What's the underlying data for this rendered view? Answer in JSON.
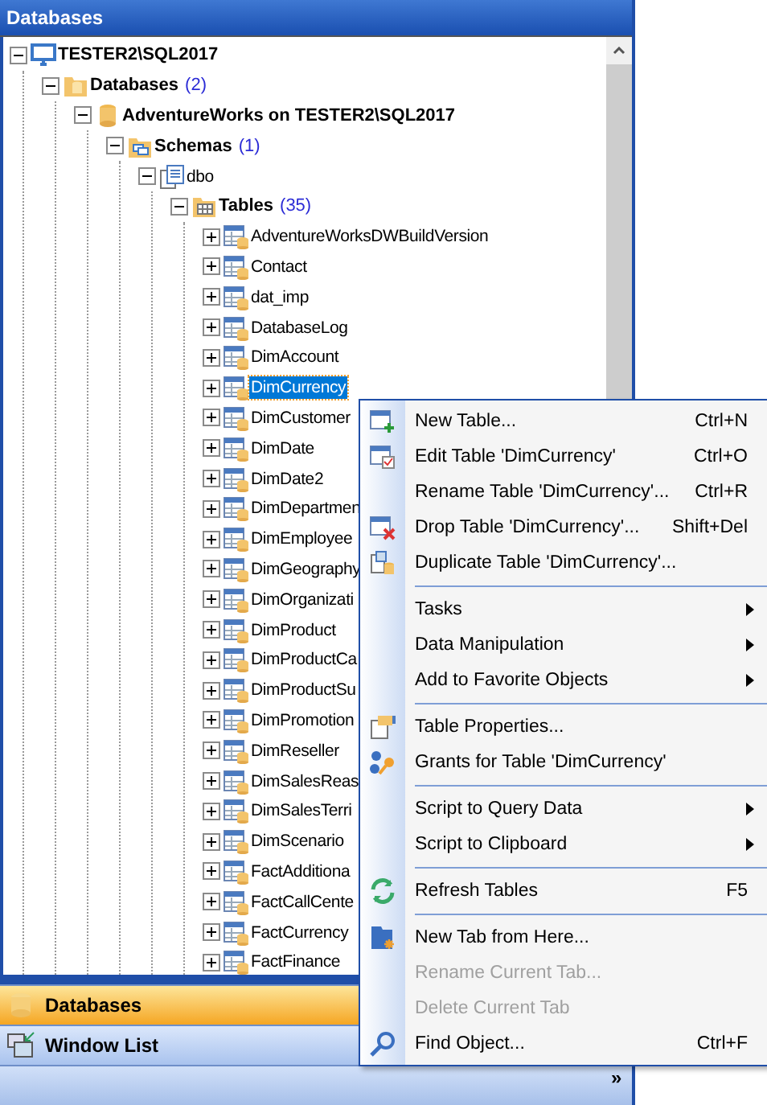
{
  "panel": {
    "title": "Databases"
  },
  "tree": [
    {
      "label": "TESTER2\\SQL2017",
      "kind": "server",
      "bold": true,
      "expanded": true,
      "selected": false,
      "children": [
        {
          "label": "Databases",
          "count": "(2)",
          "kind": "folder-db",
          "bold": true,
          "expanded": true,
          "selected": false,
          "children": [
            {
              "label": "AdventureWorks on TESTER2\\SQL2017",
              "kind": "database",
              "bold": true,
              "expanded": true,
              "selected": false,
              "children": [
                {
                  "label": "Schemas",
                  "count": "(1)",
                  "kind": "folder-schema",
                  "bold": true,
                  "expanded": true,
                  "selected": false,
                  "children": [
                    {
                      "label": "dbo",
                      "kind": "schema",
                      "bold": false,
                      "expanded": true,
                      "selected": false,
                      "children": [
                        {
                          "label": "Tables",
                          "count": "(35)",
                          "kind": "folder-table",
                          "bold": true,
                          "expanded": true,
                          "selected": false,
                          "children": [
                            {
                              "label": "AdventureWorksDWBuildVersion",
                              "kind": "table",
                              "bold": false,
                              "expanded": false,
                              "selected": false
                            },
                            {
                              "label": "Contact",
                              "kind": "table",
                              "bold": false,
                              "expanded": false,
                              "selected": false
                            },
                            {
                              "label": "dat_imp",
                              "kind": "table",
                              "bold": false,
                              "expanded": false,
                              "selected": false
                            },
                            {
                              "label": "DatabaseLog",
                              "kind": "table",
                              "bold": false,
                              "expanded": false,
                              "selected": false
                            },
                            {
                              "label": "DimAccount",
                              "kind": "table",
                              "bold": false,
                              "expanded": false,
                              "selected": false
                            },
                            {
                              "label": "DimCurrency",
                              "kind": "table",
                              "bold": false,
                              "expanded": false,
                              "selected": true
                            },
                            {
                              "label": "DimCustomer",
                              "kind": "table",
                              "bold": false,
                              "expanded": false,
                              "selected": false
                            },
                            {
                              "label": "DimDate",
                              "kind": "table",
                              "bold": false,
                              "expanded": false,
                              "selected": false
                            },
                            {
                              "label": "DimDate2",
                              "kind": "table",
                              "bold": false,
                              "expanded": false,
                              "selected": false
                            },
                            {
                              "label": "DimDepartmen",
                              "kind": "table",
                              "bold": false,
                              "expanded": false,
                              "selected": false
                            },
                            {
                              "label": "DimEmployee",
                              "kind": "table",
                              "bold": false,
                              "expanded": false,
                              "selected": false
                            },
                            {
                              "label": "DimGeography",
                              "kind": "table",
                              "bold": false,
                              "expanded": false,
                              "selected": false
                            },
                            {
                              "label": "DimOrganizati",
                              "kind": "table",
                              "bold": false,
                              "expanded": false,
                              "selected": false
                            },
                            {
                              "label": "DimProduct",
                              "kind": "table",
                              "bold": false,
                              "expanded": false,
                              "selected": false
                            },
                            {
                              "label": "DimProductCa",
                              "kind": "table",
                              "bold": false,
                              "expanded": false,
                              "selected": false
                            },
                            {
                              "label": "DimProductSu",
                              "kind": "table",
                              "bold": false,
                              "expanded": false,
                              "selected": false
                            },
                            {
                              "label": "DimPromotion",
                              "kind": "table",
                              "bold": false,
                              "expanded": false,
                              "selected": false
                            },
                            {
                              "label": "DimReseller",
                              "kind": "table",
                              "bold": false,
                              "expanded": false,
                              "selected": false
                            },
                            {
                              "label": "DimSalesReas",
                              "kind": "table",
                              "bold": false,
                              "expanded": false,
                              "selected": false
                            },
                            {
                              "label": "DimSalesTerri",
                              "kind": "table",
                              "bold": false,
                              "expanded": false,
                              "selected": false
                            },
                            {
                              "label": "DimScenario",
                              "kind": "table",
                              "bold": false,
                              "expanded": false,
                              "selected": false
                            },
                            {
                              "label": "FactAdditiona",
                              "kind": "table",
                              "bold": false,
                              "expanded": false,
                              "selected": false
                            },
                            {
                              "label": "FactCallCente",
                              "kind": "table",
                              "bold": false,
                              "expanded": false,
                              "selected": false
                            },
                            {
                              "label": "FactCurrency",
                              "kind": "table",
                              "bold": false,
                              "expanded": false,
                              "selected": false
                            },
                            {
                              "label": "FactFinance",
                              "kind": "table",
                              "bold": false,
                              "expanded": false,
                              "selected": false
                            }
                          ]
                        }
                      ]
                    }
                  ]
                }
              ]
            }
          ]
        }
      ]
    }
  ],
  "nav_buttons": [
    {
      "label": "Databases",
      "kind": "databases",
      "selected": true
    },
    {
      "label": "Window List",
      "kind": "windows",
      "selected": false
    }
  ],
  "overflow_button": "»",
  "context_menu": [
    {
      "kind": "item",
      "label": "New Table...",
      "shortcut": "Ctrl+N",
      "submenu": false,
      "disabled": false
    },
    {
      "kind": "item",
      "label": "Edit Table 'DimCurrency'",
      "shortcut": "Ctrl+O",
      "submenu": false,
      "disabled": false
    },
    {
      "kind": "item",
      "label": "Rename Table 'DimCurrency'...",
      "shortcut": "Ctrl+R",
      "submenu": false,
      "disabled": false
    },
    {
      "kind": "item",
      "label": "Drop Table 'DimCurrency'...",
      "shortcut": "Shift+Del",
      "submenu": false,
      "disabled": false
    },
    {
      "kind": "item",
      "label": "Duplicate Table 'DimCurrency'...",
      "submenu": false,
      "disabled": false
    },
    {
      "kind": "separator"
    },
    {
      "kind": "item",
      "label": "Tasks",
      "submenu": true,
      "disabled": false
    },
    {
      "kind": "item",
      "label": "Data Manipulation",
      "submenu": true,
      "disabled": false
    },
    {
      "kind": "item",
      "label": "Add to Favorite Objects",
      "submenu": true,
      "disabled": false
    },
    {
      "kind": "separator"
    },
    {
      "kind": "item",
      "label": "Table Properties...",
      "submenu": false,
      "disabled": false
    },
    {
      "kind": "item",
      "label": "Grants for Table 'DimCurrency'",
      "submenu": false,
      "disabled": false
    },
    {
      "kind": "separator"
    },
    {
      "kind": "item",
      "label": "Script to Query Data",
      "submenu": true,
      "disabled": false
    },
    {
      "kind": "item",
      "label": "Script to Clipboard",
      "submenu": true,
      "disabled": false
    },
    {
      "kind": "separator"
    },
    {
      "kind": "item",
      "label": "Refresh Tables",
      "shortcut": "F5",
      "submenu": false,
      "disabled": false
    },
    {
      "kind": "separator"
    },
    {
      "kind": "item",
      "label": "New Tab from Here...",
      "submenu": false,
      "disabled": false
    },
    {
      "kind": "item",
      "label": "Rename Current Tab...",
      "submenu": false,
      "disabled": true
    },
    {
      "kind": "item",
      "label": "Delete Current Tab",
      "submenu": false,
      "disabled": true
    },
    {
      "kind": "item",
      "label": "Find Object...",
      "shortcut": "Ctrl+F",
      "submenu": false,
      "disabled": false
    }
  ]
}
